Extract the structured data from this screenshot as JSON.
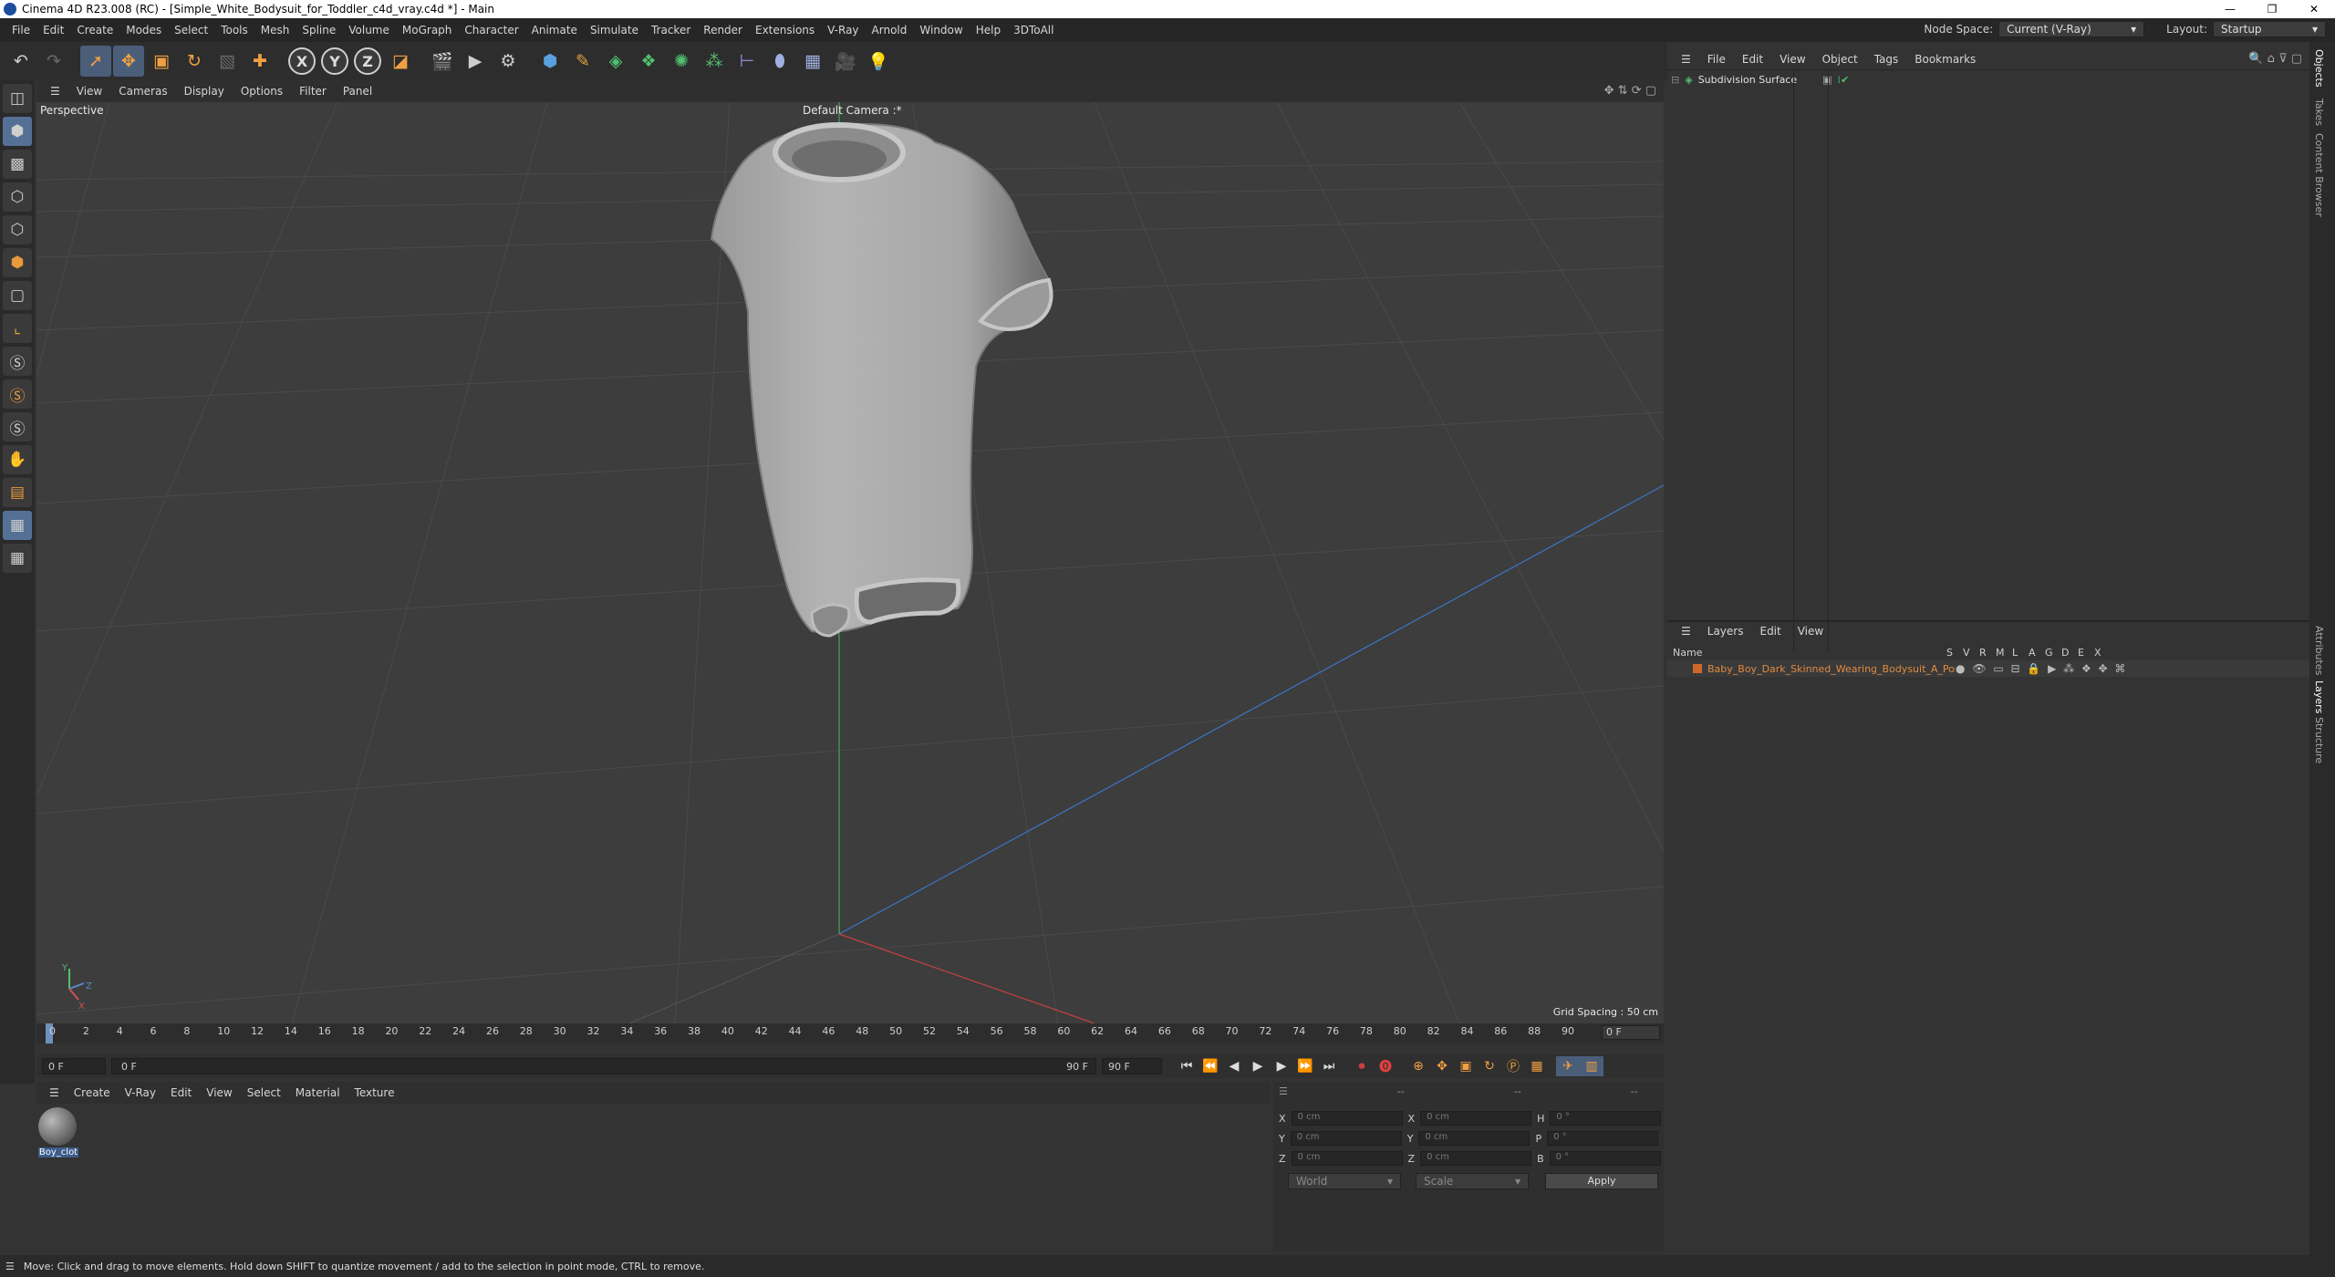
{
  "window": {
    "title": "Cinema 4D R23.008 (RC) - [Simple_White_Bodysuit_for_Toddler_c4d_vray.c4d *] - Main",
    "controls": [
      "—",
      "❐",
      "✕"
    ]
  },
  "menubar": {
    "items": [
      "File",
      "Edit",
      "Create",
      "Modes",
      "Select",
      "Tools",
      "Mesh",
      "Spline",
      "Volume",
      "MoGraph",
      "Character",
      "Animate",
      "Simulate",
      "Tracker",
      "Render",
      "Extensions",
      "V-Ray",
      "Arnold",
      "Window",
      "Help",
      "3DToAll"
    ],
    "node_space_label": "Node Space:",
    "node_space_value": "Current (V-Ray)",
    "layout_label": "Layout:",
    "layout_value": "Startup"
  },
  "viewport": {
    "menu": [
      "View",
      "Cameras",
      "Display",
      "Options",
      "Filter",
      "Panel"
    ],
    "label": "Perspective",
    "camera": "Default Camera :*",
    "grid_spacing": "Grid Spacing : 50 cm"
  },
  "timeline": {
    "ticks": [
      "0",
      "2",
      "4",
      "6",
      "8",
      "10",
      "12",
      "14",
      "16",
      "18",
      "20",
      "22",
      "24",
      "26",
      "28",
      "30",
      "32",
      "34",
      "36",
      "38",
      "40",
      "42",
      "44",
      "46",
      "48",
      "50",
      "52",
      "54",
      "56",
      "58",
      "60",
      "62",
      "64",
      "66",
      "68",
      "70",
      "72",
      "74",
      "76",
      "78",
      "80",
      "82",
      "84",
      "86",
      "88",
      "90"
    ],
    "current_frame": "0 F"
  },
  "transport": {
    "start": "0 F",
    "range_start": "0 F",
    "range_end": "90 F",
    "end": "90 F"
  },
  "material_manager": {
    "menu": [
      "Create",
      "V-Ray",
      "Edit",
      "View",
      "Select",
      "Material",
      "Texture"
    ],
    "materials": [
      {
        "name": "Boy_clot"
      }
    ]
  },
  "coordinates": {
    "rows": [
      {
        "a": "X",
        "av": "0 cm",
        "b": "X",
        "bv": "0 cm",
        "c": "H",
        "cv": "0 °"
      },
      {
        "a": "Y",
        "av": "0 cm",
        "b": "Y",
        "bv": "0 cm",
        "c": "P",
        "cv": "0 °"
      },
      {
        "a": "Z",
        "av": "0 cm",
        "b": "Z",
        "bv": "0 cm",
        "c": "B",
        "cv": "0 °"
      }
    ],
    "mode1": "World",
    "mode2": "Scale",
    "apply": "Apply",
    "header1": "--",
    "header2": "--",
    "header3": "--"
  },
  "objects_panel": {
    "menu": [
      "File",
      "Edit",
      "View",
      "Object",
      "Tags",
      "Bookmarks"
    ],
    "objects": [
      {
        "name": "Subdivision Surface"
      }
    ]
  },
  "layers_panel": {
    "menu": [
      "Layers",
      "Edit",
      "View"
    ],
    "name_col": "Name",
    "flag_cols": [
      "S",
      "V",
      "R",
      "M",
      "L",
      "A",
      "G",
      "D",
      "E",
      "X"
    ],
    "layers": [
      {
        "name": "Baby_Boy_Dark_Skinned_Wearing_Bodysuit_A_Pose",
        "color": "#d0662a"
      }
    ]
  },
  "side_tabs": [
    "Objects",
    "Takes",
    "Content Browser",
    "Attributes",
    "Layers",
    "Structure"
  ],
  "status": "Move: Click and drag to move elements. Hold down SHIFT to quantize movement / add to the selection in point mode, CTRL to remove."
}
